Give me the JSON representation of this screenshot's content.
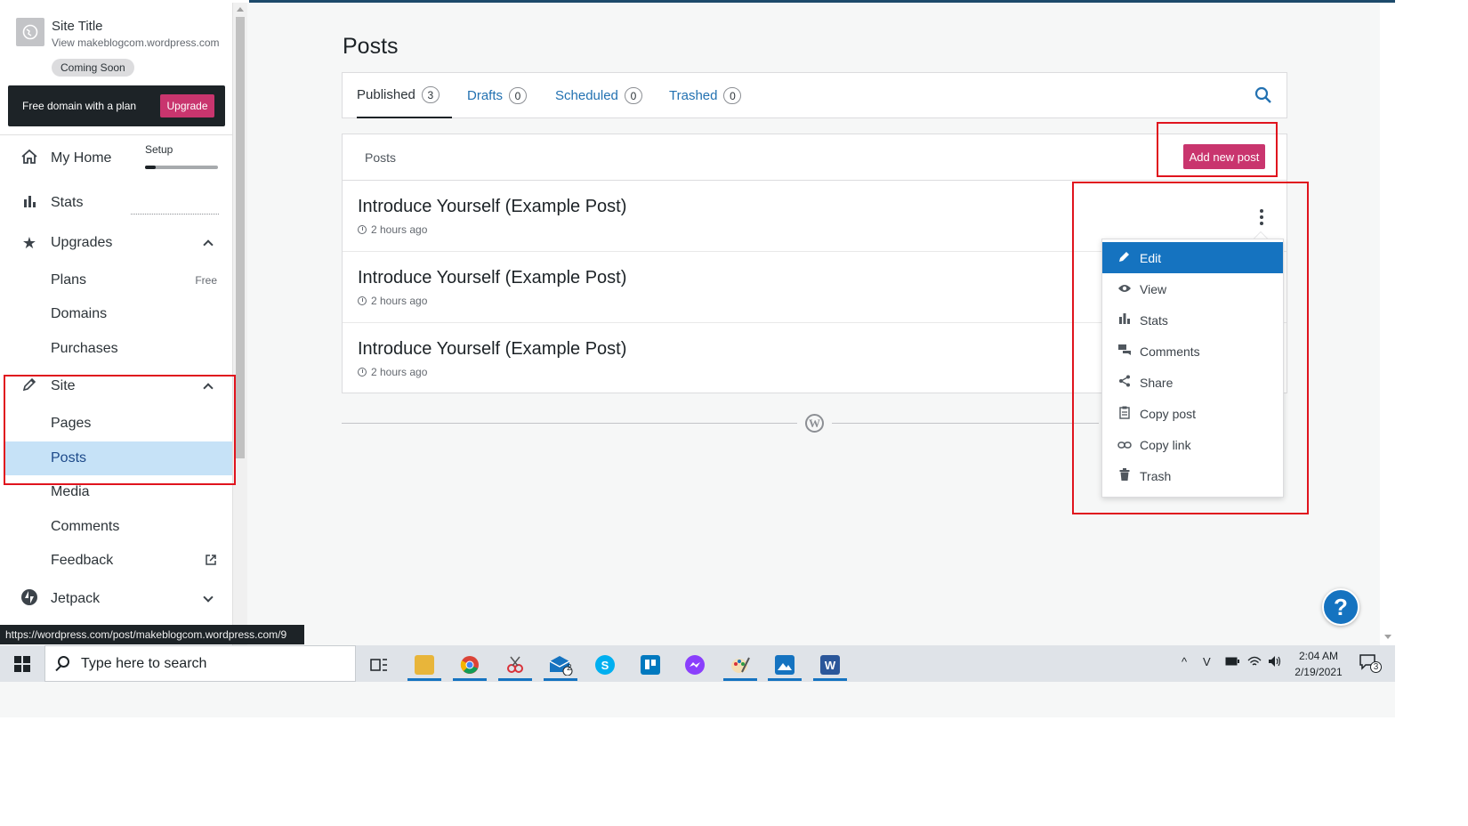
{
  "sidebar": {
    "site_title": "Site Title",
    "site_url": "View makeblogcom.wordpress.com",
    "coming_soon": "Coming Soon",
    "promo_text": "Free domain with a plan",
    "upgrade_label": "Upgrade",
    "setup_label": "Setup",
    "setup_progress": 0.15,
    "items": [
      {
        "label": "My Home",
        "icon": "home-icon"
      },
      {
        "label": "Stats",
        "icon": "bar-chart-icon"
      },
      {
        "label": "Upgrades",
        "icon": "star-icon"
      },
      {
        "label": "Plans",
        "badge": "Free"
      },
      {
        "label": "Domains"
      },
      {
        "label": "Purchases"
      },
      {
        "label": "Site",
        "icon": "pencil-icon"
      },
      {
        "label": "Pages"
      },
      {
        "label": "Posts",
        "active": true
      },
      {
        "label": "Media"
      },
      {
        "label": "Comments"
      },
      {
        "label": "Feedback",
        "icon": "external-link-icon"
      },
      {
        "label": "Jetpack",
        "icon": "jetpack-icon"
      }
    ]
  },
  "status_url": "https://wordpress.com/post/makeblogcom.wordpress.com/9",
  "main": {
    "page_title": "Posts",
    "tabs": [
      {
        "label": "Published",
        "count": "3"
      },
      {
        "label": "Drafts",
        "count": "0"
      },
      {
        "label": "Scheduled",
        "count": "0"
      },
      {
        "label": "Trashed",
        "count": "0"
      }
    ],
    "list_header": "Posts",
    "add_new_label": "Add new post",
    "posts": [
      {
        "title": "Introduce Yourself (Example Post)",
        "time": "2 hours ago"
      },
      {
        "title": "Introduce Yourself (Example Post)",
        "time": "2 hours ago"
      },
      {
        "title": "Introduce Yourself (Example Post)",
        "time": "2 hours ago"
      }
    ]
  },
  "post_menu": {
    "items": [
      {
        "label": "Edit",
        "icon": "pencil-icon"
      },
      {
        "label": "View",
        "icon": "eye-icon"
      },
      {
        "label": "Stats",
        "icon": "bar-chart-icon"
      },
      {
        "label": "Comments",
        "icon": "comments-icon"
      },
      {
        "label": "Share",
        "icon": "share-icon"
      },
      {
        "label": "Copy post",
        "icon": "clipboard-icon"
      },
      {
        "label": "Copy link",
        "icon": "link-icon"
      },
      {
        "label": "Trash",
        "icon": "trash-icon"
      }
    ]
  },
  "help_label": "?",
  "taskbar": {
    "search_placeholder": "Type here to search",
    "time": "2:04 AM",
    "date": "2/19/2021",
    "mail_badge": "2",
    "notification_badge": "3"
  },
  "colors": {
    "accent_pink": "#c9356e",
    "link_blue": "#2271b1",
    "menu_highlight": "#1573c0",
    "annotation_red": "#e0141e"
  }
}
